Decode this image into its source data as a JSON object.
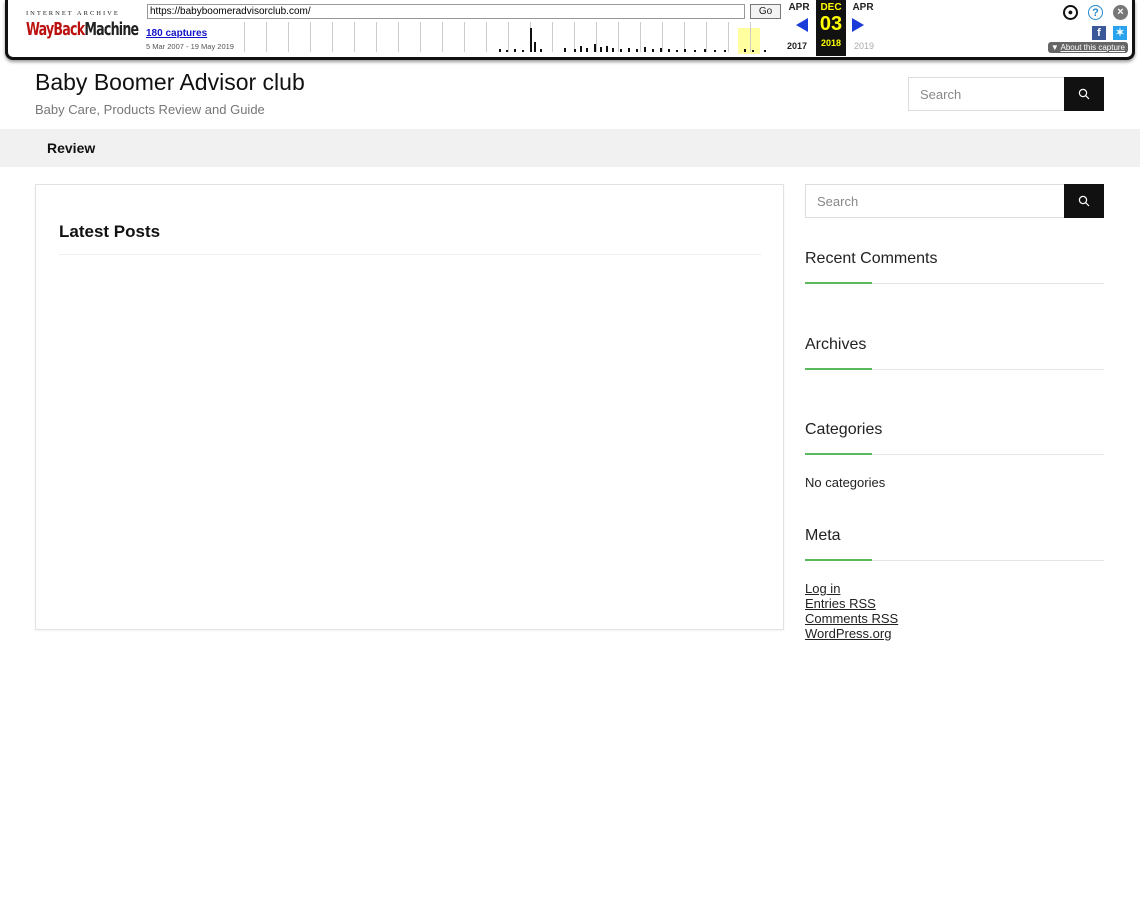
{
  "wayback": {
    "logo_top": "INTERNET ARCHIVE",
    "logo_way": "WayBack",
    "logo_machine": "Machine",
    "url": "https://babyboomeradvisorclub.com/",
    "go": "Go",
    "captures": "180 captures",
    "range": "5 Mar 2007 - 19 May 2019",
    "prev_month": "APR",
    "cur_month": "DEC",
    "next_month": "APR",
    "cur_day": "03",
    "prev_year": "2017",
    "cur_year": "2018",
    "next_year": "2019",
    "about": "About this capture",
    "accent": "#1a3bd9"
  },
  "header": {
    "title": "Baby Boomer Advisor club",
    "tagline": "Baby Care, Products Review and Guide",
    "search_placeholder": "Search"
  },
  "nav": {
    "items": [
      {
        "label": "Review"
      }
    ]
  },
  "main": {
    "heading": "Latest Posts"
  },
  "sidebar": {
    "search_placeholder": "Search",
    "recent_comments": "Recent Comments",
    "archives": "Archives",
    "categories": "Categories",
    "no_categories": "No categories",
    "meta": "Meta",
    "meta_links": [
      "Log in",
      "Entries RSS",
      "Comments RSS",
      "WordPress.org"
    ],
    "accent": "#5cb85c"
  }
}
